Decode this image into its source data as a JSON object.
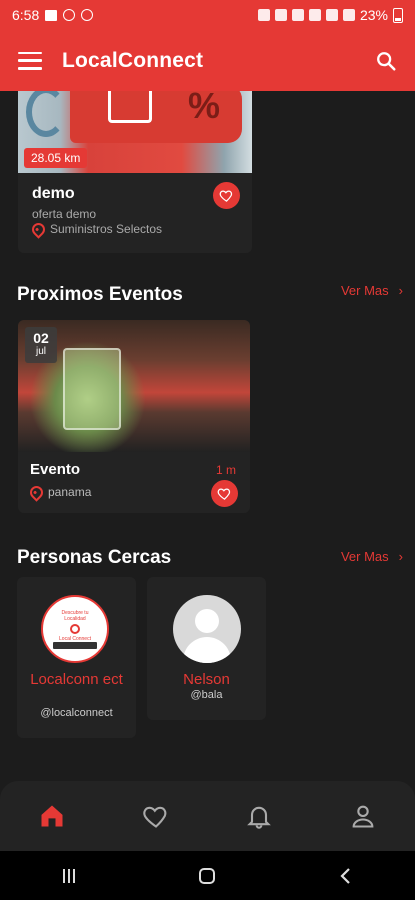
{
  "status_bar": {
    "time": "6:58",
    "battery": "23%"
  },
  "app_bar": {
    "title": "LocalConnect",
    "menu_icon": "hamburger-menu-icon",
    "search_icon": "search-icon"
  },
  "offer": {
    "distance": "28.05 km",
    "title": "demo",
    "description": "oferta demo",
    "store": "Suministros Selectos"
  },
  "events_section": {
    "title": "Proximos Eventos",
    "ver_mas": "Ver Mas"
  },
  "event": {
    "day": "02",
    "month": "jul",
    "title": "Evento",
    "time": "1 m",
    "place": "panama"
  },
  "people_section": {
    "title": "Personas Cercas",
    "ver_mas": "Ver Mas"
  },
  "people": [
    {
      "name": "Localconn ect",
      "handle": "@localconnect",
      "logo_line1": "Descubre tu",
      "logo_line2": "Localidad",
      "logo_line3": "Local Connect"
    },
    {
      "name": "Nelson",
      "handle": "@bala"
    }
  ],
  "bottom_nav": [
    "home-icon",
    "heart-icon",
    "bell-icon",
    "user-icon"
  ],
  "colors": {
    "accent": "#e53935",
    "background": "#1c1c1c",
    "card": "#232323"
  }
}
